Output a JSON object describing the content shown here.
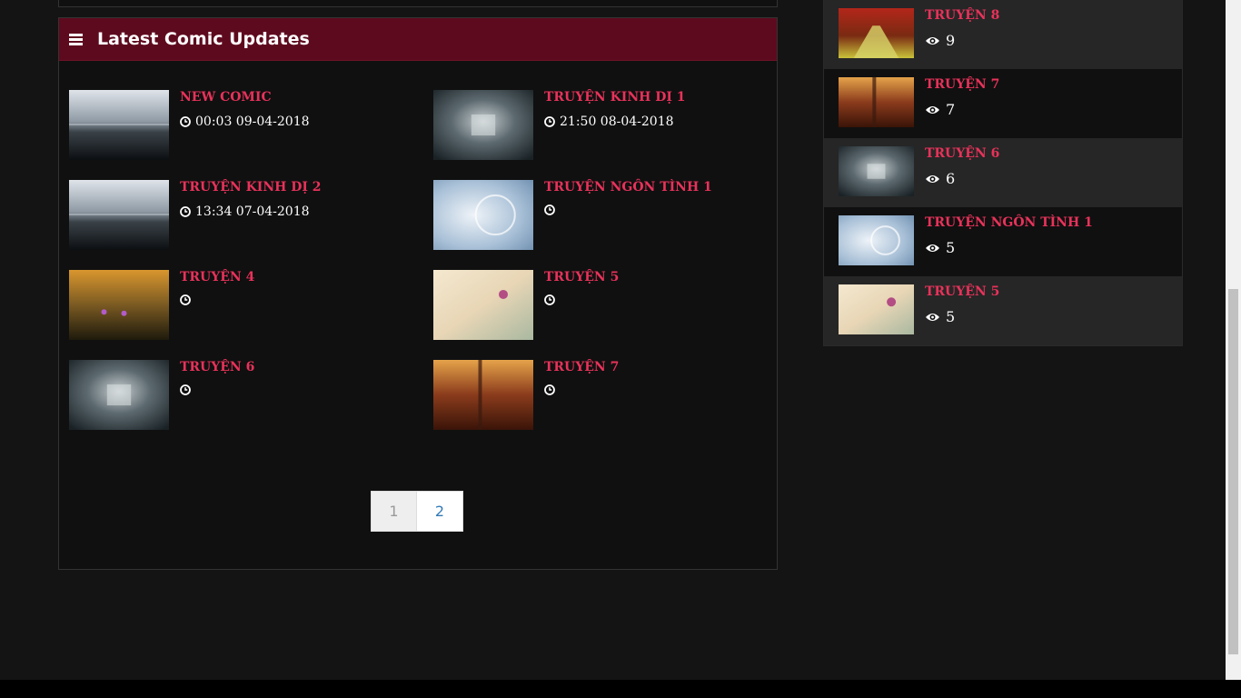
{
  "panel": {
    "title": "Latest Comic Updates",
    "comics": [
      {
        "title": "NEW COMIC",
        "time": "00:03 09-04-2018",
        "thumb": "fog"
      },
      {
        "title": "TRUYỆN KINH DỊ 1",
        "time": "21:50 08-04-2018",
        "thumb": "gazebo"
      },
      {
        "title": "TRUYỆN KINH DỊ 2",
        "time": "13:34 07-04-2018",
        "thumb": "fog"
      },
      {
        "title": "TRUYỆN NGÔN TÌNH 1",
        "time": "",
        "thumb": "snowflake"
      },
      {
        "title": "TRUYỆN 4",
        "time": "",
        "thumb": "grass"
      },
      {
        "title": "TRUYỆN 5",
        "time": "",
        "thumb": "flower"
      },
      {
        "title": "TRUYỆN 6",
        "time": "",
        "thumb": "gazebo"
      },
      {
        "title": "TRUYỆN 7",
        "time": "",
        "thumb": "autumn"
      }
    ],
    "pagination": {
      "current": "1",
      "next": "2"
    }
  },
  "sidebar": {
    "items": [
      {
        "title": "TRUYỆN 8",
        "views": "9",
        "thumb": "road"
      },
      {
        "title": "TRUYỆN 7",
        "views": "7",
        "thumb": "autumn"
      },
      {
        "title": "TRUYỆN 6",
        "views": "6",
        "thumb": "gazebo"
      },
      {
        "title": "TRUYỆN NGÔN TÌNH 1",
        "views": "5",
        "thumb": "snowflake"
      },
      {
        "title": "TRUYỆN 5",
        "views": "5",
        "thumb": "flower"
      }
    ]
  },
  "icons": {
    "menu": "hamburger-icon",
    "time": "clock-icon",
    "views": "eye-icon"
  },
  "colors": {
    "header_bg": "#5e0a1e",
    "title_accent": "#e8325a",
    "link": "#337ab7"
  }
}
